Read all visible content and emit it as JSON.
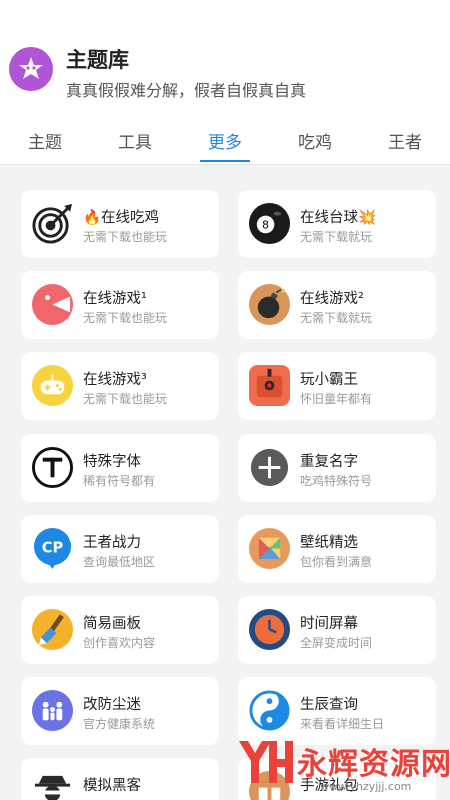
{
  "header": {
    "title": "主题库",
    "subtitle": "真真假假难分解，假者自假真自真"
  },
  "tabs": [
    "主题",
    "工具",
    "更多",
    "吃鸡",
    "王者"
  ],
  "active_tab": 2,
  "cards": [
    {
      "title": "🔥在线吃鸡",
      "sub": "无需下载也能玩",
      "icon": "target-icon"
    },
    {
      "title": "在线台球💥",
      "sub": "无需下载就玩",
      "icon": "billiard-ball-icon"
    },
    {
      "title": "在线游戏¹",
      "sub": "无需下载也能玩",
      "icon": "pacman-icon"
    },
    {
      "title": "在线游戏²",
      "sub": "无需下载就玩",
      "icon": "bomb-icon"
    },
    {
      "title": "在线游戏³",
      "sub": "无需下载也能玩",
      "icon": "gamepad-icon"
    },
    {
      "title": "玩小霸王",
      "sub": "怀旧童年都有",
      "icon": "console-icon"
    },
    {
      "title": "特殊字体",
      "sub": "稀有符号都有",
      "icon": "font-t-icon"
    },
    {
      "title": "重复名字",
      "sub": "吃鸡特殊符号",
      "icon": "plus-icon"
    },
    {
      "title": "王者战力",
      "sub": "查询最低地区",
      "icon": "cp-icon"
    },
    {
      "title": "壁纸精选",
      "sub": "包你看到满意",
      "icon": "wallpaper-icon"
    },
    {
      "title": "简易画板",
      "sub": "创作喜欢内容",
      "icon": "brush-icon"
    },
    {
      "title": "时间屏幕",
      "sub": "全屏变成时间",
      "icon": "clock-icon"
    },
    {
      "title": "改防尘迷",
      "sub": "官方健康系统",
      "icon": "family-icon"
    },
    {
      "title": "生辰查询",
      "sub": "来看看详细生日",
      "icon": "yin-yang-icon"
    },
    {
      "title": "模拟黑客",
      "sub": "",
      "icon": "hacker-icon"
    },
    {
      "title": "手游礼包",
      "sub": "",
      "icon": "gift-icon"
    }
  ],
  "watermark": {
    "text": "永辉资源网",
    "url": "www.yhzyjjj.com"
  }
}
